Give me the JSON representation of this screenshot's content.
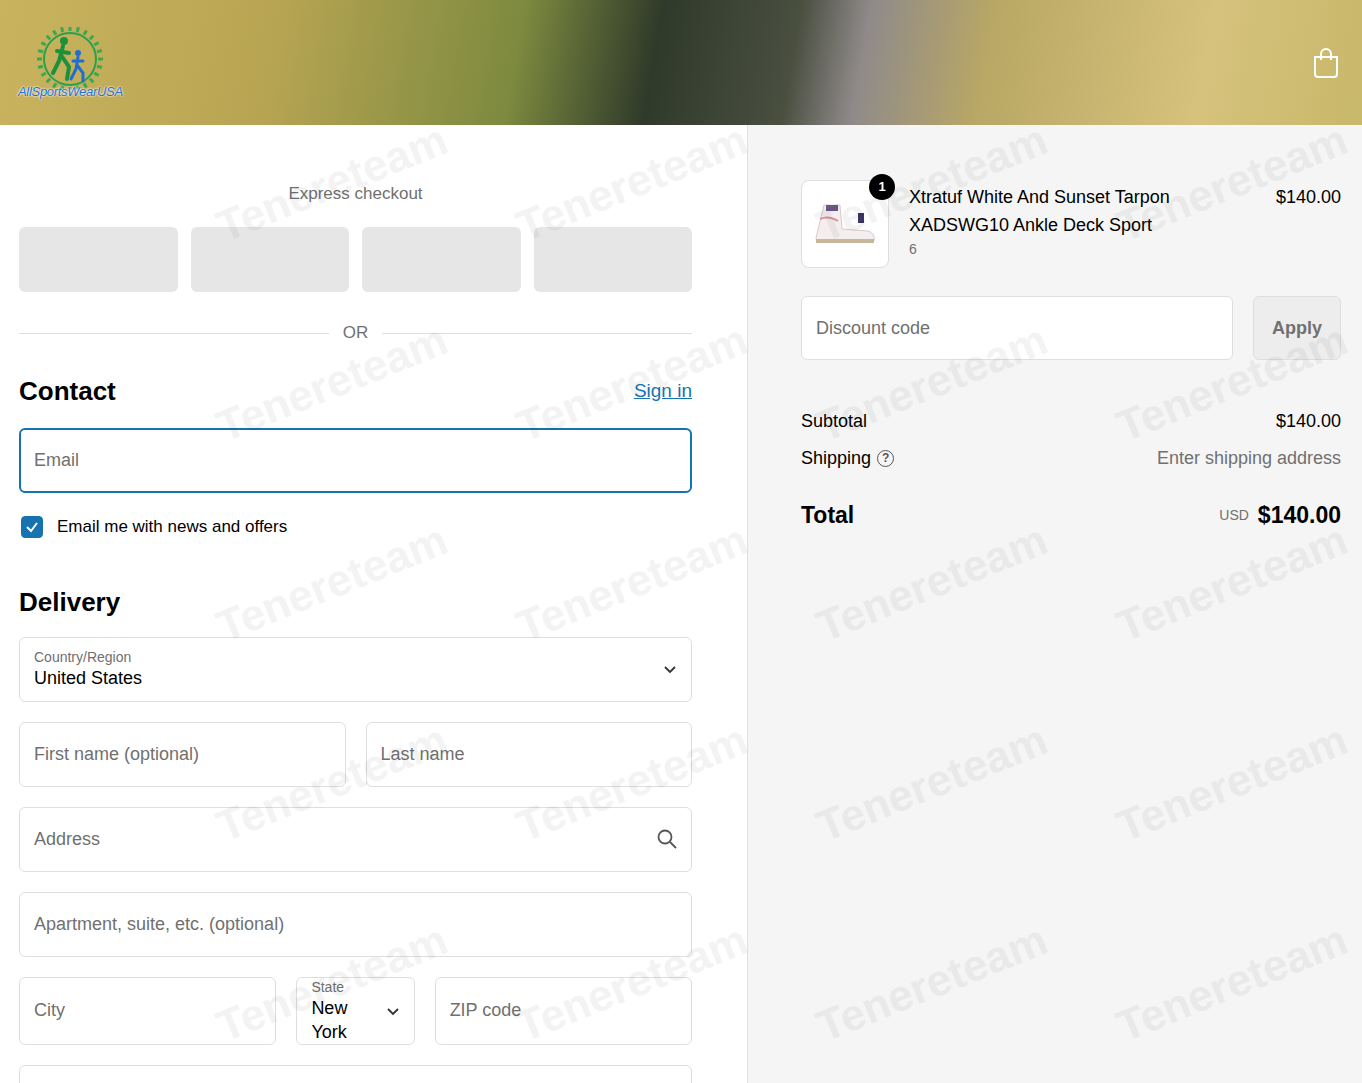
{
  "header": {
    "logo_text": "AllSportsWearUSA"
  },
  "express_checkout": {
    "title": "Express checkout",
    "buttons": [
      {
        "loading": true
      },
      {
        "loading": true
      },
      {
        "loading": true
      },
      {
        "loading": true
      }
    ]
  },
  "divider": "OR",
  "contact": {
    "title": "Contact",
    "sign_in": "Sign in",
    "email": {
      "placeholder": "Email",
      "focused": true
    },
    "newsletter": {
      "label": "Email me with news and offers",
      "checked": true
    }
  },
  "delivery": {
    "title": "Delivery",
    "rows": [
      [
        {
          "kind": "select",
          "label": "Country/Region",
          "value": "United States"
        }
      ],
      [
        {
          "kind": "input",
          "placeholder": "First name (optional)"
        },
        {
          "kind": "input",
          "placeholder": "Last name"
        }
      ],
      [
        {
          "kind": "search",
          "placeholder": "Address"
        }
      ],
      [
        {
          "kind": "input",
          "placeholder": "Apartment, suite, etc. (optional)"
        }
      ],
      [
        {
          "kind": "input",
          "placeholder": "City"
        },
        {
          "kind": "select",
          "label": "State",
          "value": "New York"
        },
        {
          "kind": "input",
          "placeholder": "ZIP code"
        }
      ]
    ]
  },
  "cart": {
    "items": [
      {
        "name": "Xtratuf White And Sunset Tarpon XADSWG10 Ankle Deck Sport",
        "variant": "6",
        "quantity": "1",
        "price": "$140.00"
      }
    ],
    "discount": {
      "placeholder": "Discount code",
      "button": "Apply"
    },
    "subtotal": {
      "label": "Subtotal",
      "value": "$140.00"
    },
    "shipping": {
      "label": "Shipping",
      "help_icon": "?",
      "value": "Enter shipping address"
    },
    "total": {
      "label": "Total",
      "currency": "USD",
      "value": "$140.00"
    }
  },
  "watermark": {
    "text": "Tenereteam"
  }
}
